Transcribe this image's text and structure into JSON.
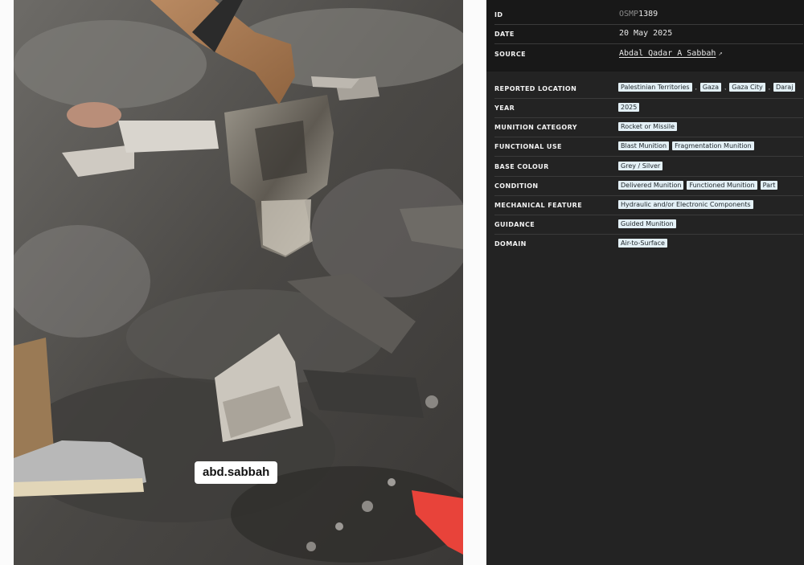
{
  "photo": {
    "watermark": "abd.sabbah"
  },
  "metadata": {
    "id_label": "ID",
    "id_prefix": "OSMP",
    "id_number": "1389",
    "date_label": "DATE",
    "date_value": "20 May 2025",
    "source_label": "SOURCE",
    "source_value": "Abdal Qadar A Sabbah",
    "source_arrow": "↗"
  },
  "attributes": {
    "reported_location": {
      "label": "REPORTED LOCATION",
      "tags": [
        "Palestinian Territories",
        "Gaza",
        "Gaza City",
        "Daraj"
      ]
    },
    "year": {
      "label": "YEAR",
      "tags": [
        "2025"
      ]
    },
    "munition_category": {
      "label": "MUNITION CATEGORY",
      "tags": [
        "Rocket or Missile"
      ]
    },
    "functional_use": {
      "label": "FUNCTIONAL USE",
      "tags": [
        "Blast Munition",
        "Fragmentation Munition"
      ]
    },
    "base_colour": {
      "label": "BASE COLOUR",
      "tags": [
        "Grey / Silver"
      ]
    },
    "condition": {
      "label": "CONDITION",
      "tags": [
        "Delivered Munition",
        "Functioned Munition",
        "Part"
      ]
    },
    "mechanical_feature": {
      "label": "MECHANICAL FEATURE",
      "tags": [
        "Hydraulic and/or Electronic Components"
      ]
    },
    "guidance": {
      "label": "GUIDANCE",
      "tags": [
        "Guided Munition"
      ]
    },
    "domain": {
      "label": "DOMAIN",
      "tags": [
        "Air-to-Surface"
      ]
    }
  },
  "colors": {
    "panel_bg": "#232323",
    "meta_bg": "#181818",
    "tag_bg": "#e3f0f6"
  }
}
